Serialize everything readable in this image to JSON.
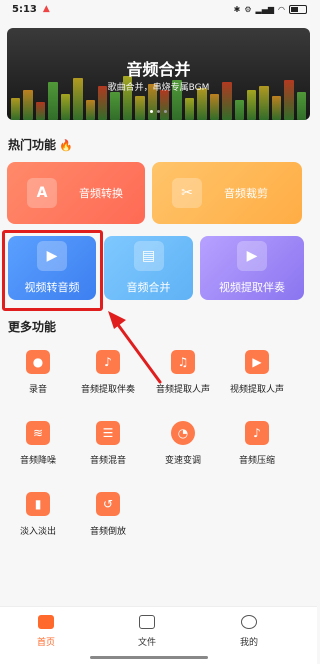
{
  "status": {
    "time": "5:13",
    "icons": [
      "bluetooth-icon",
      "settings-icon",
      "signal-icon",
      "wifi-icon",
      "battery-icon"
    ]
  },
  "banner": {
    "title": "音频合并",
    "subtitle": "歌曲合并，串烧专属BGM",
    "pages": 3,
    "active_page": 0
  },
  "hot": {
    "title": "热门功能",
    "cards": [
      {
        "label": "音频转换",
        "icon": "audio-convert-icon",
        "color": "#ff7a5e"
      },
      {
        "label": "音频裁剪",
        "icon": "audio-cut-icon",
        "color": "#ffb74d"
      },
      {
        "label": "视频转音频",
        "icon": "video-to-audio-icon",
        "color": "#4a8ff6"
      },
      {
        "label": "音频合并",
        "icon": "audio-merge-icon",
        "color": "#6cbcf8"
      },
      {
        "label": "视频提取伴奏",
        "icon": "video-extract-accompaniment-icon",
        "color": "#9f89f6"
      }
    ]
  },
  "more": {
    "title": "更多功能",
    "items": [
      {
        "label": "录音",
        "icon": "microphone-icon"
      },
      {
        "label": "音频提取伴奏",
        "icon": "audio-extract-accompaniment-icon"
      },
      {
        "label": "音频提取人声",
        "icon": "audio-extract-vocal-icon"
      },
      {
        "label": "视频提取人声",
        "icon": "video-extract-vocal-icon"
      },
      {
        "label": "音频降噪",
        "icon": "noise-reduction-icon"
      },
      {
        "label": "音频混音",
        "icon": "mixer-icon"
      },
      {
        "label": "变速变调",
        "icon": "speed-pitch-icon"
      },
      {
        "label": "音频压缩",
        "icon": "audio-compress-icon"
      },
      {
        "label": "淡入淡出",
        "icon": "fade-icon"
      },
      {
        "label": "音频倒放",
        "icon": "audio-reverse-icon"
      }
    ]
  },
  "tabs": [
    {
      "label": "首页",
      "active": true
    },
    {
      "label": "文件",
      "active": false
    },
    {
      "label": "我的",
      "active": false
    }
  ]
}
